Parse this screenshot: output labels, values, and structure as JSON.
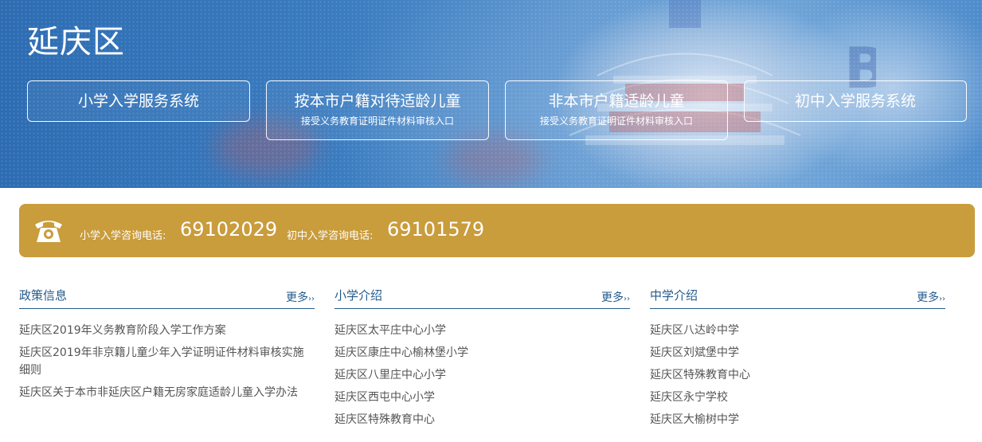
{
  "hero": {
    "title": "延庆区",
    "buttons": [
      {
        "label": "小学入学服务系统",
        "sub": ""
      },
      {
        "label": "按本市户籍对待适龄儿童",
        "sub": "接受义务教育证明证件材料审核入口"
      },
      {
        "label": "非本市户籍适龄儿童",
        "sub": "接受义务教育证明证件材料审核入口"
      },
      {
        "label": "初中入学服务系统",
        "sub": ""
      }
    ]
  },
  "hotline": {
    "icon": "telephone-icon",
    "primary_label": "小学入学咨询电话:",
    "primary_number": "69102029",
    "middle_label": "初中入学咨询电话:",
    "middle_number": "69101579",
    "color": "#c99c3c"
  },
  "columns": {
    "more_label": "更多",
    "more_arrow": "››",
    "policy": {
      "title": "政策信息",
      "items": [
        "延庆区2019年义务教育阶段入学工作方案",
        "延庆区2019年非京籍儿童少年入学证明证件材料审核实施细则",
        "延庆区关于本市非延庆区户籍无房家庭适龄儿童入学办法"
      ]
    },
    "primary": {
      "title": "小学介绍",
      "items": [
        "延庆区太平庄中心小学",
        "延庆区康庄中心榆林堡小学",
        "延庆区八里庄中心小学",
        "延庆区西屯中心小学",
        "延庆区特殊教育中心"
      ]
    },
    "middle": {
      "title": "中学介绍",
      "items": [
        "延庆区八达岭中学",
        "延庆区刘斌堡中学",
        "延庆区特殊教育中心",
        "延庆区永宁学校",
        "延庆区大榆树中学"
      ]
    }
  },
  "colors": {
    "accent_blue": "#245a8b",
    "hero_blue": "#3a7cc0",
    "gold": "#c99c3c"
  }
}
